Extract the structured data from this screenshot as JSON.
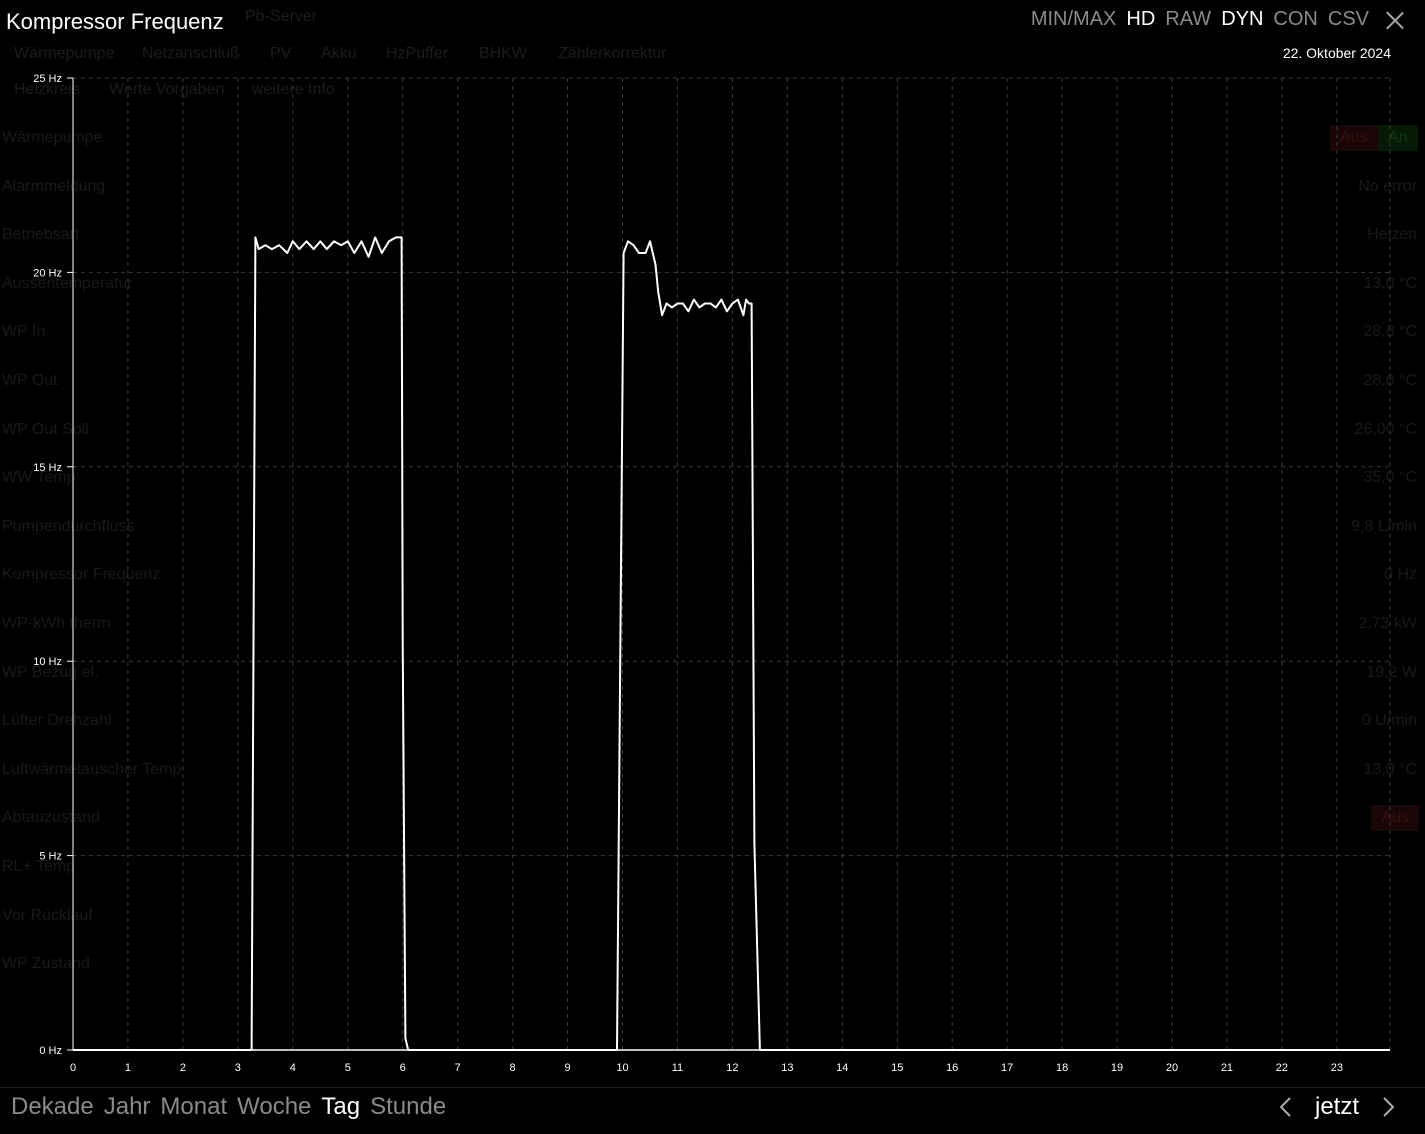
{
  "background": {
    "tabs_row1": [
      "Wärmepumpe",
      "Netzanschluß",
      "PV",
      "Akku",
      "HzPuffer",
      "BHKW",
      "Zählerkorrektur"
    ],
    "tabs_row2": [
      "Heizkreis",
      "Werte Vorgaben",
      "weitere Info"
    ],
    "header_partial": "Pb-Server",
    "buttons": {
      "aus": "Aus",
      "an": "An"
    },
    "rows": [
      {
        "label": "Wärmepumpe",
        "value": ""
      },
      {
        "label": "Alarmmeldung",
        "value": "No error"
      },
      {
        "label": "Betriebsart",
        "value": "Heizen"
      },
      {
        "label": "Aussentemperatur",
        "value": "13,0 °C"
      },
      {
        "label": "WP In",
        "value": "28,8 °C"
      },
      {
        "label": "WP Out",
        "value": "28,8 °C"
      },
      {
        "label": "WP Out Soll",
        "value": "26,00 °C"
      },
      {
        "label": "WW Temp",
        "value": "35,0 °C"
      },
      {
        "label": "Pumpendurchfluss",
        "value": "9,8 L/min"
      },
      {
        "label": "Kompressor Frequenz",
        "value": "0 Hz"
      },
      {
        "label": "WP-kWh therm",
        "value": "2,73 kW"
      },
      {
        "label": "WP Bezug el.",
        "value": "19,2 W"
      },
      {
        "label": "Lüfter Drehzahl",
        "value": "0 U/min"
      },
      {
        "label": "Luftwärmetauscher Temp",
        "value": "13,0 °C"
      },
      {
        "label": "Abtauzustand",
        "value": "Aus"
      },
      {
        "label": "RL+ Temp",
        "value": ""
      },
      {
        "label": "Vor Rücklauf",
        "value": ""
      },
      {
        "label": "WP Zustand",
        "value": ""
      }
    ]
  },
  "modal": {
    "title": "Kompressor Frequenz",
    "date": "22. Oktober 2024",
    "modes": [
      {
        "label": "MIN/MAX",
        "active": false
      },
      {
        "label": "HD",
        "active": true
      },
      {
        "label": "RAW",
        "active": false
      },
      {
        "label": "DYN",
        "active": true
      },
      {
        "label": "CON",
        "active": false
      },
      {
        "label": "CSV",
        "active": false
      }
    ],
    "close_icon": "close-icon"
  },
  "ranges": [
    {
      "label": "Dekade",
      "active": false
    },
    {
      "label": "Jahr",
      "active": false
    },
    {
      "label": "Monat",
      "active": false
    },
    {
      "label": "Woche",
      "active": false
    },
    {
      "label": "Tag",
      "active": true
    },
    {
      "label": "Stunde",
      "active": false
    }
  ],
  "nav": {
    "now_label": "jetzt",
    "prev_icon": "chevron-left-icon",
    "next_icon": "chevron-right-icon"
  },
  "colors": {
    "line": "#ffffff",
    "grid": "#3a3a3a",
    "axis": "#ffffff",
    "inactive": "#8a8a8a"
  },
  "chart_data": {
    "type": "line",
    "title": "Kompressor Frequenz",
    "xlabel": "",
    "ylabel": "",
    "xlim": [
      0,
      24
    ],
    "ylim": [
      0,
      25
    ],
    "x_ticks": [
      0,
      1,
      2,
      3,
      4,
      5,
      6,
      7,
      8,
      9,
      10,
      11,
      12,
      13,
      14,
      15,
      16,
      17,
      18,
      19,
      20,
      21,
      22,
      23
    ],
    "y_ticks": [
      0,
      5,
      10,
      15,
      20,
      25
    ],
    "y_tick_labels": [
      "0 Hz",
      "5 Hz",
      "10 Hz",
      "15 Hz",
      "20 Hz",
      "25 Hz"
    ],
    "grid": true,
    "series": [
      {
        "x": [
          0,
          3.25,
          3.32,
          3.38,
          3.5,
          3.62,
          3.75,
          3.9,
          4.0,
          4.12,
          4.25,
          4.38,
          4.5,
          4.62,
          4.75,
          4.88,
          5.0,
          5.12,
          5.25,
          5.38,
          5.5,
          5.62,
          5.75,
          5.88,
          5.98,
          6.0,
          6.05,
          6.1,
          9.9,
          10.02,
          10.1,
          10.2,
          10.3,
          10.42,
          10.5,
          10.6,
          10.65,
          10.72,
          10.8,
          10.9,
          11.0,
          11.1,
          11.2,
          11.3,
          11.4,
          11.5,
          11.6,
          11.7,
          11.8,
          11.9,
          12.0,
          12.1,
          12.2,
          12.25,
          12.3,
          12.35,
          12.4,
          12.5,
          25
        ],
        "y": [
          0,
          0,
          20.9,
          20.6,
          20.7,
          20.6,
          20.7,
          20.5,
          20.8,
          20.6,
          20.8,
          20.6,
          20.8,
          20.6,
          20.8,
          20.7,
          20.8,
          20.5,
          20.8,
          20.4,
          20.9,
          20.5,
          20.8,
          20.9,
          20.9,
          10.5,
          0.3,
          0,
          0,
          20.5,
          20.8,
          20.7,
          20.5,
          20.5,
          20.8,
          20.2,
          19.5,
          18.9,
          19.2,
          19.1,
          19.2,
          19.2,
          19.0,
          19.3,
          19.1,
          19.2,
          19.2,
          19.1,
          19.3,
          19.0,
          19.2,
          19.3,
          18.9,
          19.3,
          19.2,
          19.2,
          5.3,
          0,
          0
        ]
      }
    ]
  }
}
